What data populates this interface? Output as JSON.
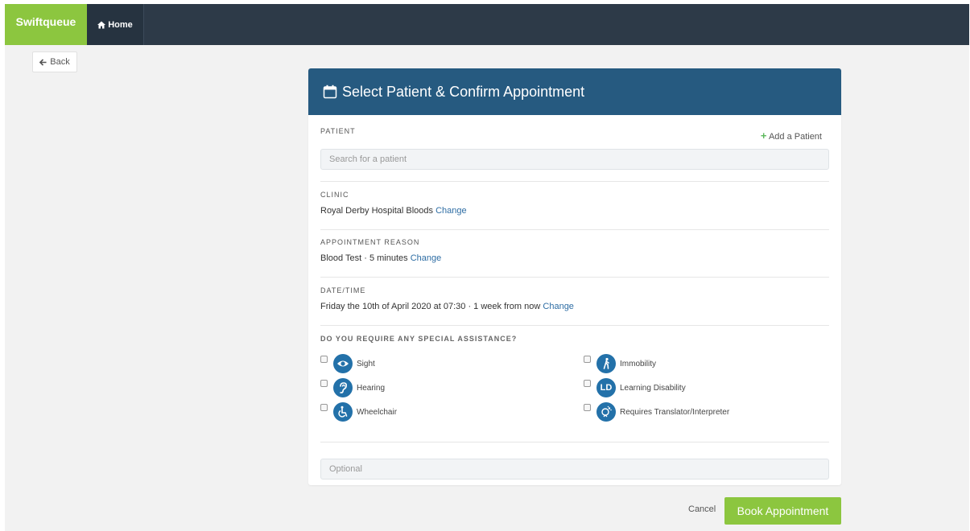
{
  "nav": {
    "brand": "Swiftqueue",
    "home": "Home"
  },
  "back": {
    "label": "Back"
  },
  "panel": {
    "title": "Select Patient & Confirm Appointment",
    "patient": {
      "label": "PATIENT",
      "add_label": "Add a Patient",
      "search_placeholder": "Search for a patient"
    },
    "clinic": {
      "label": "CLINIC",
      "value": "Royal Derby Hospital Bloods",
      "change": "Change"
    },
    "reason": {
      "label": "APPOINTMENT REASON",
      "value": "Blood Test · 5 minutes",
      "change": "Change"
    },
    "datetime": {
      "label": "DATE/TIME",
      "value": "Friday the 10th of April 2020 at 07:30 · 1 week from now",
      "change": "Change"
    },
    "assistance": {
      "label": "DO YOU REQUIRE ANY SPECIAL ASSISTANCE?",
      "options": [
        {
          "label": "Sight",
          "icon": "eye-icon"
        },
        {
          "label": "Immobility",
          "icon": "walking-person-icon"
        },
        {
          "label": "Hearing",
          "icon": "ear-icon"
        },
        {
          "label": "Learning Disability",
          "icon": "ld-icon",
          "icon_text": "LD"
        },
        {
          "label": "Wheelchair",
          "icon": "wheelchair-icon"
        },
        {
          "label": "Requires Translator/Interpreter",
          "icon": "interpreter-icon"
        }
      ]
    },
    "optional_placeholder": "Optional"
  },
  "footer": {
    "cancel": "Cancel",
    "book": "Book Appointment"
  },
  "colors": {
    "brand_green": "#8cc63f",
    "nav_dark": "#2d3a48",
    "header_blue": "#265a80",
    "icon_blue": "#2371a9",
    "link_blue": "#2e6da4"
  }
}
